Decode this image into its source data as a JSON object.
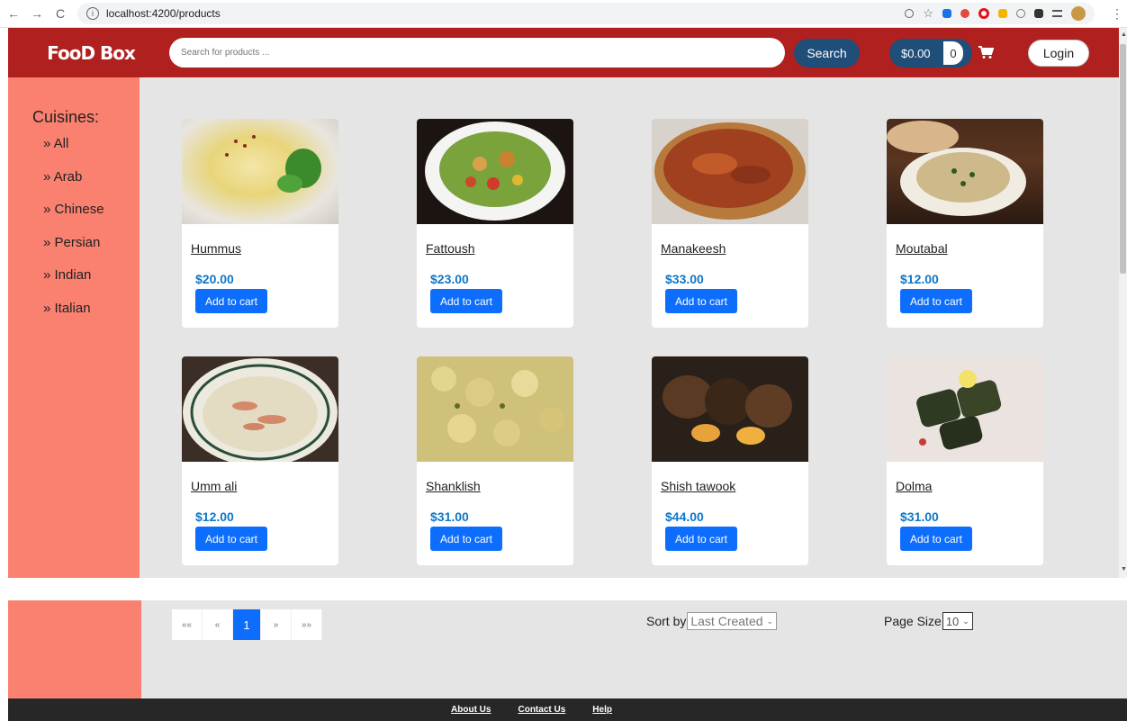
{
  "browser": {
    "url": "localhost:4200/products"
  },
  "header": {
    "logo_text": "FooD Box",
    "search_placeholder": "Search for products ...",
    "search_label": "Search",
    "cart_total": "$0.00",
    "cart_count": "0",
    "login_label": "Login",
    "brand_color": "#b0201f",
    "accent_color": "#1f4e79"
  },
  "sidebar": {
    "title": "Cuisines:",
    "items": [
      {
        "label": "» All"
      },
      {
        "label": "» Arab"
      },
      {
        "label": "» Chinese"
      },
      {
        "label": "» Persian"
      },
      {
        "label": "» Indian"
      },
      {
        "label": "» Italian"
      }
    ]
  },
  "products": [
    {
      "name": "Hummus",
      "price": "$20.00",
      "button": "Add to cart"
    },
    {
      "name": "Fattoush",
      "price": "$23.00",
      "button": "Add to cart"
    },
    {
      "name": "Manakeesh",
      "price": "$33.00",
      "button": "Add to cart"
    },
    {
      "name": "Moutabal",
      "price": "$12.00",
      "button": "Add to cart"
    },
    {
      "name": "Umm ali",
      "price": "$12.00",
      "button": "Add to cart"
    },
    {
      "name": "Shanklish",
      "price": "$31.00",
      "button": "Add to cart"
    },
    {
      "name": "Shish tawook",
      "price": "$44.00",
      "button": "Add to cart"
    },
    {
      "name": "Dolma",
      "price": "$31.00",
      "button": "Add to cart"
    }
  ],
  "pagination": {
    "first": "««",
    "prev": "«",
    "current": "1",
    "next": "»",
    "last": "»»"
  },
  "sort": {
    "label": "Sort by",
    "value": "Last Created"
  },
  "page_size": {
    "label": "Page Size",
    "value": "10"
  },
  "footer": {
    "links": [
      "About Us",
      "Contact Us",
      "Help"
    ]
  }
}
